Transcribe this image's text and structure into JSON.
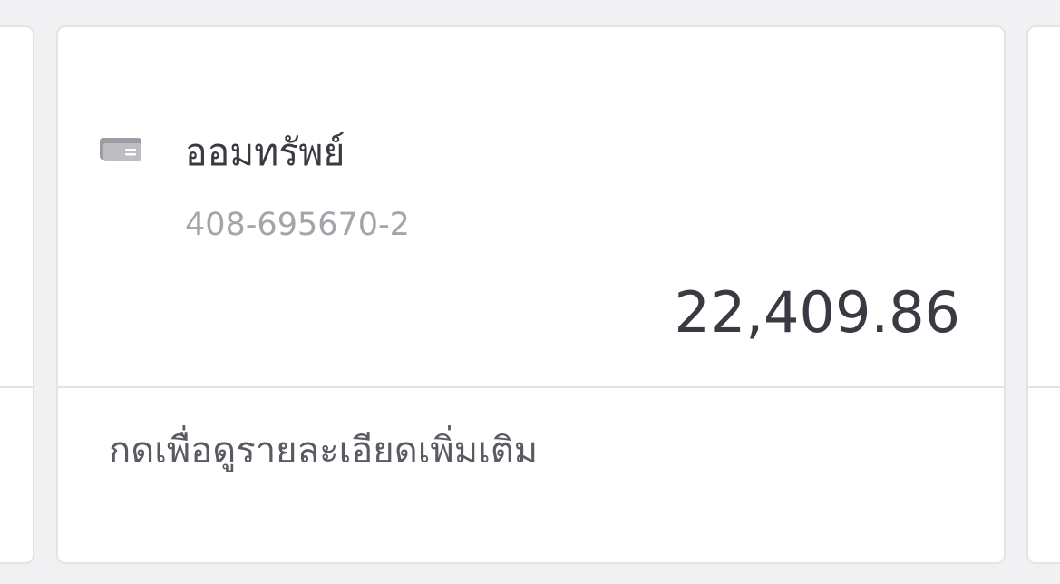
{
  "account": {
    "name": "ออมทรัพย์",
    "number": "408-695670-2",
    "balance": "22,409.86",
    "icon": "card-icon"
  },
  "footer": {
    "detail_link": "กดเพื่อดูรายละเอียดเพิ่มเติม"
  },
  "colors": {
    "background": "#f1f1f3",
    "card": "#ffffff",
    "border": "#e4e4e7",
    "text_primary": "#3a3a42",
    "text_secondary": "#a4a4aa",
    "icon": "#a0a0a6"
  }
}
